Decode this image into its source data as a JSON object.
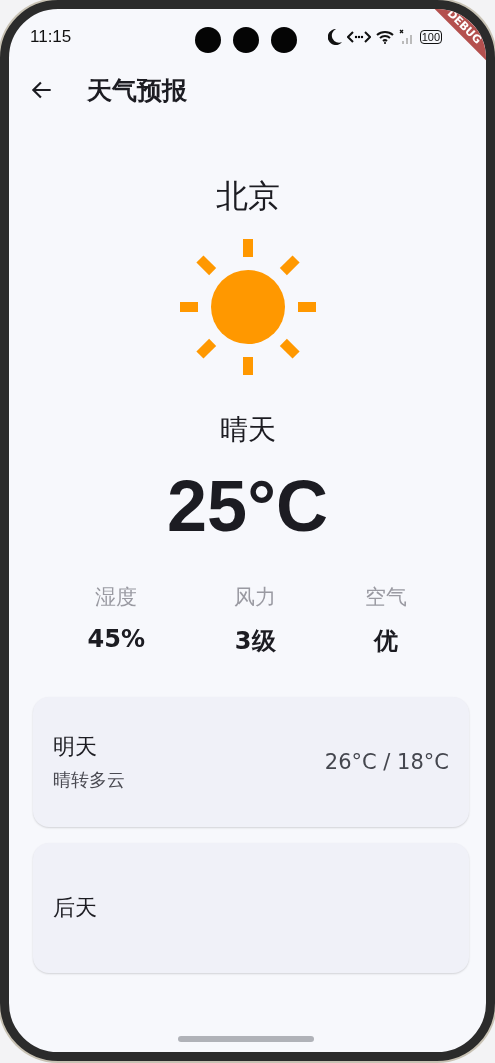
{
  "status_bar": {
    "time": "11:15",
    "battery": "100"
  },
  "app_bar": {
    "title": "天气预报"
  },
  "debug_banner": "DEBUG",
  "current": {
    "city": "北京",
    "condition": "晴天",
    "temperature": "25°C"
  },
  "stats": [
    {
      "label": "湿度",
      "value": "45%"
    },
    {
      "label": "风力",
      "value": "3级"
    },
    {
      "label": "空气",
      "value": "优"
    }
  ],
  "forecast": [
    {
      "day": "明天",
      "condition": "晴转多云",
      "temps": "26°C / 18°C"
    },
    {
      "day": "后天"
    }
  ]
}
